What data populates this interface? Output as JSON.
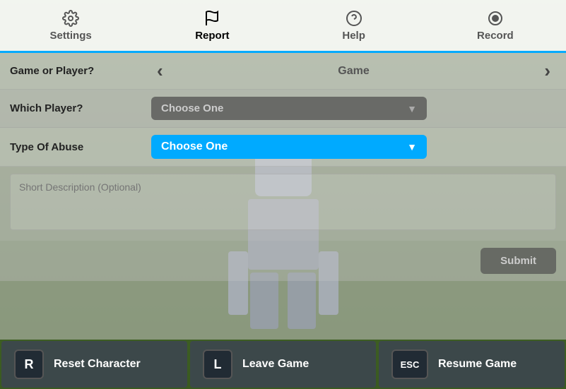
{
  "nav": {
    "items": [
      {
        "id": "settings",
        "label": "Settings",
        "icon": "gear"
      },
      {
        "id": "report",
        "label": "Report",
        "icon": "flag",
        "active": true
      },
      {
        "id": "help",
        "label": "Help",
        "icon": "question"
      },
      {
        "id": "record",
        "label": "Record",
        "icon": "record"
      }
    ]
  },
  "form": {
    "game_or_player_label": "Game or Player?",
    "game_value": "Game",
    "which_player_label": "Which Player?",
    "which_player_placeholder": "Choose One",
    "type_of_abuse_label": "Type Of Abuse",
    "type_of_abuse_placeholder": "Choose One",
    "description_placeholder": "Short Description (Optional)",
    "submit_label": "Submit"
  },
  "bottom": {
    "reset": {
      "key": "R",
      "label": "Reset Character"
    },
    "leave": {
      "key": "L",
      "label": "Leave Game"
    },
    "resume": {
      "key": "ESC",
      "label": "Resume Game"
    }
  }
}
